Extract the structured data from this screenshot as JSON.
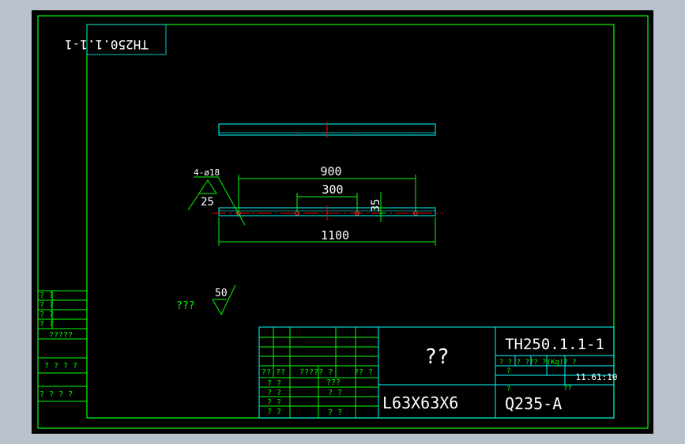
{
  "drawing": {
    "drawing_number": "TH250.1.1-1",
    "corner_label": "TH250.1.1-1",
    "part_name": "??",
    "section": "L63X63X6",
    "material": "Q235-A",
    "weight_scale": "11.61:10",
    "weight_header": "? ? ? ??? ?(Kg)? ?",
    "weight_sub_1": "?",
    "weight_sub_2": "??",
    "weight_sub_3": "?"
  },
  "dimensions": {
    "hole_callout": "4-ø18",
    "hole_spacing_total": "900",
    "hole_spacing_mid": "300",
    "edge_offset": "35",
    "overall_length": "1100",
    "roughness_value": "25"
  },
  "finish_note": {
    "text": "???",
    "roughness_value": "50"
  },
  "side_table": {
    "rows": [
      "? ?",
      "? ?",
      "? ?",
      "? ?",
      "?????",
      "? ? ? ?",
      "? ? ?   ?"
    ]
  },
  "revision_table": {
    "header": [
      "?? ??",
      "????? ?",
      "?? ?"
    ],
    "rows": [
      [
        "? ?",
        "???"
      ],
      [
        "? ?",
        "? ?"
      ],
      [
        "? ?",
        ""
      ],
      [
        "? ?",
        "? ?"
      ]
    ]
  },
  "colors": {
    "frame": "#00ff00",
    "outline": "#00ffff",
    "center_line": "#ff0000",
    "text": "#ffffff",
    "background": "#000000"
  }
}
